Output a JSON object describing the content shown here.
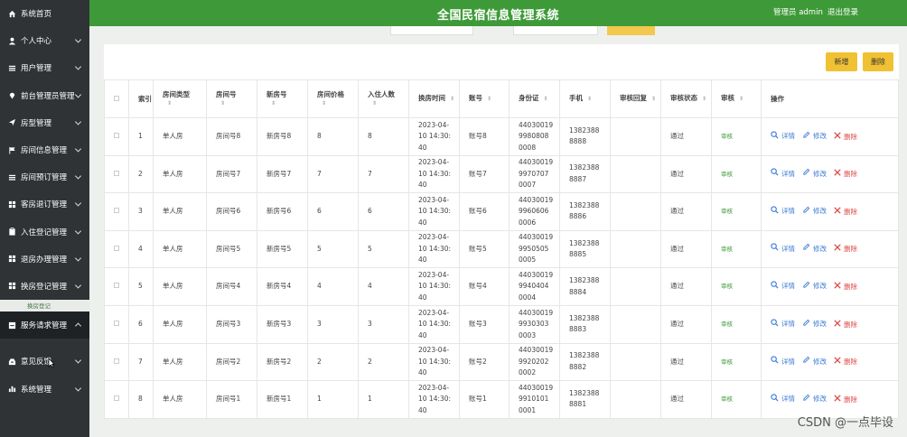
{
  "header": {
    "title": "全国民宿信息管理系统",
    "admin": "管理员 admin",
    "logout": "退出登录"
  },
  "sidebar": {
    "items": [
      {
        "label": "系统首页",
        "icon": "home-icon"
      },
      {
        "label": "个人中心",
        "icon": "user-icon"
      },
      {
        "label": "用户管理",
        "icon": "menu-icon"
      },
      {
        "label": "前台管理员管理",
        "icon": "location-icon"
      },
      {
        "label": "房型管理",
        "icon": "send-icon"
      },
      {
        "label": "房间信息管理",
        "icon": "flag-icon"
      },
      {
        "label": "房间预订管理",
        "icon": "menu-icon"
      },
      {
        "label": "客房退订管理",
        "icon": "grid-icon"
      },
      {
        "label": "入住登记管理",
        "icon": "clipboard-icon"
      },
      {
        "label": "退房办理管理",
        "icon": "grid-icon"
      },
      {
        "label": "换房登记管理",
        "icon": "grid-icon"
      },
      {
        "label": "服务请求管理",
        "icon": "minus-box-icon"
      },
      {
        "label": "意见反馈",
        "icon": "inbox-icon"
      },
      {
        "label": "系统管理",
        "icon": "bar-chart-icon"
      }
    ],
    "submenu_label": "换房登记"
  },
  "toolbar": {
    "add_label": "新增",
    "delete_label": "删除"
  },
  "table": {
    "headers": [
      "索引",
      "房间类型",
      "房间号",
      "新房号",
      "房间价格",
      "入住人数",
      "换房时间",
      "账号",
      "身份证",
      "手机",
      "审核回复",
      "审核状态",
      "审核",
      "操作"
    ],
    "rows": [
      {
        "idx": "1",
        "type": "单人房",
        "room": "房间号8",
        "newroom": "新房号8",
        "price": "8",
        "people": "8",
        "time1": "2023-04-",
        "time2": "10 14:30:",
        "time3": "40",
        "account": "账号8",
        "id1": "44030019",
        "id2": "9980808",
        "id3": "0008",
        "phone1": "1382388",
        "phone2": "8888",
        "reply": "",
        "status": "通过",
        "audit": "审核"
      },
      {
        "idx": "2",
        "type": "单人房",
        "room": "房间号7",
        "newroom": "新房号7",
        "price": "7",
        "people": "7",
        "time1": "2023-04-",
        "time2": "10 14:30:",
        "time3": "40",
        "account": "账号7",
        "id1": "44030019",
        "id2": "9970707",
        "id3": "0007",
        "phone1": "1382388",
        "phone2": "8887",
        "reply": "",
        "status": "通过",
        "audit": "审核"
      },
      {
        "idx": "3",
        "type": "单人房",
        "room": "房间号6",
        "newroom": "新房号6",
        "price": "6",
        "people": "6",
        "time1": "2023-04-",
        "time2": "10 14:30:",
        "time3": "40",
        "account": "账号6",
        "id1": "44030019",
        "id2": "9960606",
        "id3": "0006",
        "phone1": "1382388",
        "phone2": "8886",
        "reply": "",
        "status": "通过",
        "audit": "审核"
      },
      {
        "idx": "4",
        "type": "单人房",
        "room": "房间号5",
        "newroom": "新房号5",
        "price": "5",
        "people": "5",
        "time1": "2023-04-",
        "time2": "10 14:30:",
        "time3": "40",
        "account": "账号5",
        "id1": "44030019",
        "id2": "9950505",
        "id3": "0005",
        "phone1": "1382388",
        "phone2": "8885",
        "reply": "",
        "status": "通过",
        "audit": "审核"
      },
      {
        "idx": "5",
        "type": "单人房",
        "room": "房间号4",
        "newroom": "新房号4",
        "price": "4",
        "people": "4",
        "time1": "2023-04-",
        "time2": "10 14:30:",
        "time3": "40",
        "account": "账号4",
        "id1": "44030019",
        "id2": "9940404",
        "id3": "0004",
        "phone1": "1382388",
        "phone2": "8884",
        "reply": "",
        "status": "通过",
        "audit": "审核"
      },
      {
        "idx": "6",
        "type": "单人房",
        "room": "房间号3",
        "newroom": "新房号3",
        "price": "3",
        "people": "3",
        "time1": "2023-04-",
        "time2": "10 14:30:",
        "time3": "40",
        "account": "账号3",
        "id1": "44030019",
        "id2": "9930303",
        "id3": "0003",
        "phone1": "1382388",
        "phone2": "8883",
        "reply": "",
        "status": "通过",
        "audit": "审核"
      },
      {
        "idx": "7",
        "type": "单人房",
        "room": "房间号2",
        "newroom": "新房号2",
        "price": "2",
        "people": "2",
        "time1": "2023-04-",
        "time2": "10 14:30:",
        "time3": "40",
        "account": "账号2",
        "id1": "44030019",
        "id2": "9920202",
        "id3": "0002",
        "phone1": "1382388",
        "phone2": "8882",
        "reply": "",
        "status": "通过",
        "audit": "审核"
      },
      {
        "idx": "8",
        "type": "单人房",
        "room": "房间号1",
        "newroom": "新房号1",
        "price": "1",
        "people": "1",
        "time1": "2023-04-",
        "time2": "10 14:30:",
        "time3": "40",
        "account": "账号1",
        "id1": "44030019",
        "id2": "9910101",
        "id3": "0001",
        "phone1": "1382388",
        "phone2": "8881",
        "reply": "",
        "status": "通过",
        "audit": "审核"
      }
    ],
    "ops": {
      "detail": "详情",
      "edit": "修改",
      "delete": "删除"
    }
  },
  "watermark": "CSDN @一点毕设",
  "colors": {
    "header_green": "#3e9a38",
    "sidebar_bg": "#2f3335",
    "button_yellow": "#f0c133",
    "link_blue": "#3a7bd5",
    "delete_red": "#e04646"
  }
}
